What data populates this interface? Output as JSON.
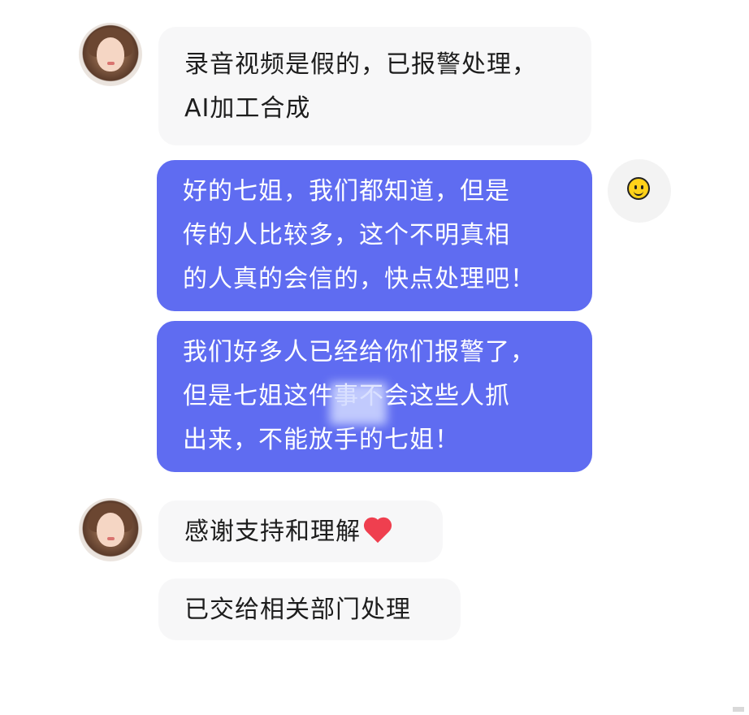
{
  "colors": {
    "incoming_bubble": "#f7f7f8",
    "outgoing_bubble": "#5f6cf1",
    "heart": "#ef3f4f"
  },
  "messages": [
    {
      "side": "incoming",
      "avatar": "woman-photo-avatar",
      "lines": [
        "录音视频是假的，已报警处理，",
        "AI加工合成"
      ]
    },
    {
      "side": "outgoing",
      "avatar": "smiley-avatar",
      "lines": [
        "好的七姐，我们都知道，但是",
        "传的人比较多，这个不明真相",
        "的人真的会信的，快点处理吧！"
      ]
    },
    {
      "side": "outgoing",
      "lines": [
        "我们好多人已经给你们报警了，",
        "但是七姐这件事不会这些人抓",
        "出来，不能放手的七姐！"
      ]
    },
    {
      "side": "incoming",
      "avatar": "woman-photo-avatar",
      "lines": [
        "感谢支持和理解"
      ],
      "emoji": "heart-emoji"
    },
    {
      "side": "incoming",
      "lines": [
        "已交给相关部门处理"
      ]
    }
  ]
}
